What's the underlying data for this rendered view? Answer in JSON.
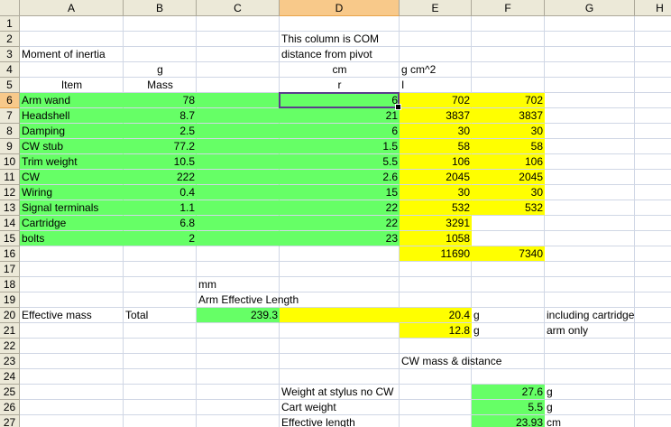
{
  "columns": [
    "A",
    "B",
    "C",
    "D",
    "E",
    "F",
    "G",
    "H"
  ],
  "selected_column": "D",
  "selected_row": 6,
  "active_cell": "D6",
  "rows": [
    {
      "n": "1",
      "cells": {}
    },
    {
      "n": "2",
      "cells": {
        "D": "This column is COM"
      }
    },
    {
      "n": "3",
      "cells": {
        "A": "Moment of inertia",
        "D": "distance from pivot"
      }
    },
    {
      "n": "4",
      "cells": {
        "B": "g",
        "D": "cm",
        "E": "g cm^2"
      }
    },
    {
      "n": "5",
      "cells": {
        "A": "Item",
        "B": "Mass",
        "D": "r",
        "E": "I"
      }
    },
    {
      "n": "6",
      "cells": {
        "A": "Arm wand",
        "B": "78",
        "D": "6",
        "E": "702",
        "F": "702"
      }
    },
    {
      "n": "7",
      "cells": {
        "A": "Headshell",
        "B": "8.7",
        "D": "21",
        "E": "3837",
        "F": "3837"
      }
    },
    {
      "n": "8",
      "cells": {
        "A": "Damping",
        "B": "2.5",
        "D": "6",
        "E": "30",
        "F": "30"
      }
    },
    {
      "n": "9",
      "cells": {
        "A": "CW stub",
        "B": "77.2",
        "D": "1.5",
        "E": "58",
        "F": "58"
      }
    },
    {
      "n": "10",
      "cells": {
        "A": "Trim weight",
        "B": "10.5",
        "D": "5.5",
        "E": "106",
        "F": "106"
      }
    },
    {
      "n": "11",
      "cells": {
        "A": "CW",
        "B": "222",
        "D": "2.6",
        "E": "2045",
        "F": "2045"
      }
    },
    {
      "n": "12",
      "cells": {
        "A": "Wiring",
        "B": "0.4",
        "D": "15",
        "E": "30",
        "F": "30"
      }
    },
    {
      "n": "13",
      "cells": {
        "A": "Signal terminals",
        "B": "1.1",
        "D": "22",
        "E": "532",
        "F": "532"
      }
    },
    {
      "n": "14",
      "cells": {
        "A": "Cartridge",
        "B": "6.8",
        "D": "22",
        "E": "3291"
      }
    },
    {
      "n": "15",
      "cells": {
        "A": "bolts",
        "B": "2",
        "D": "23",
        "E": "1058"
      }
    },
    {
      "n": "16",
      "cells": {
        "E": "11690",
        "F": "7340"
      }
    },
    {
      "n": "17",
      "cells": {}
    },
    {
      "n": "18",
      "cells": {
        "C": "mm"
      }
    },
    {
      "n": "19",
      "cells": {
        "C": "Arm Effective Length"
      }
    },
    {
      "n": "20",
      "cells": {
        "A": "Effective mass",
        "B": "Total",
        "C": "239.3",
        "E": "20.4",
        "F": "g",
        "G": "including cartridge"
      }
    },
    {
      "n": "21",
      "cells": {
        "E": "12.8",
        "F": "g",
        "G": "arm only"
      }
    },
    {
      "n": "22",
      "cells": {}
    },
    {
      "n": "23",
      "cells": {
        "E": "CW mass & distance"
      }
    },
    {
      "n": "24",
      "cells": {}
    },
    {
      "n": "25",
      "cells": {
        "D": "Weight at stylus no CW",
        "F": "27.6",
        "G": "g"
      }
    },
    {
      "n": "26",
      "cells": {
        "D": "Cart weight",
        "F": "5.5",
        "G": "g"
      }
    },
    {
      "n": "27",
      "cells": {
        "D": "Effective length",
        "F": "23.93",
        "G": "cm"
      }
    }
  ],
  "colors": {
    "green": "#66ff66",
    "yellow": "#ffff00",
    "header": "#ece9d8",
    "header_selected": "#f8c98a"
  }
}
